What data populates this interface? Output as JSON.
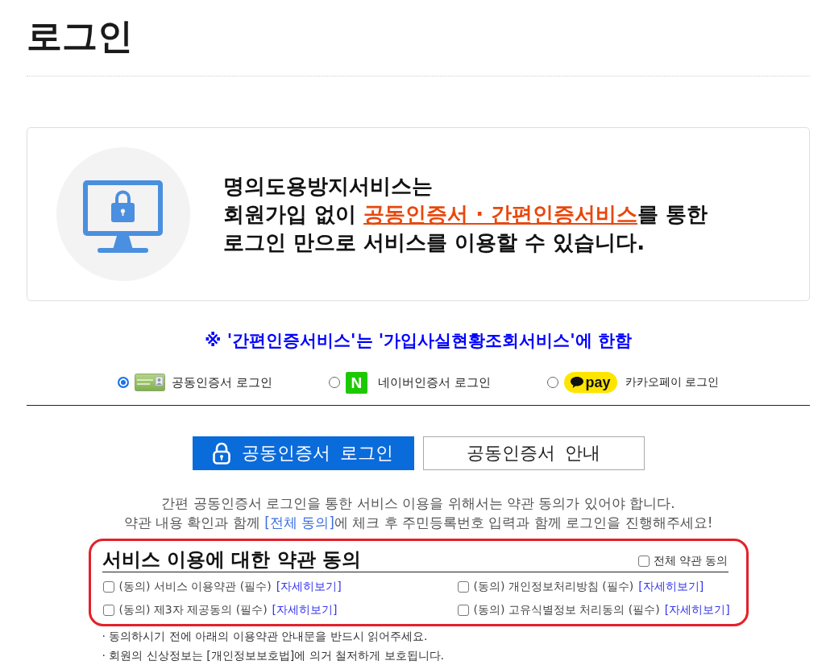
{
  "page_title": "로그인",
  "intro": {
    "line_1": "명의도용방지서비스는",
    "line_2_before": "회원가입 없이 ",
    "link": "공동인증서 · 간편인증서비스",
    "line_2_after": "를 통한",
    "line_3": "로그인 만으로 서비스를 이용할 수 있습니다."
  },
  "notice": "※ '간편인증서비스'는 '가입사실현황조회서비스'에 한함",
  "login_methods": [
    {
      "kind": "certificate",
      "label": "공동인증서 로그인",
      "selected": true
    },
    {
      "kind": "naver",
      "logo_text": "N",
      "label": "네이버인증서 로그인",
      "selected": false
    },
    {
      "kind": "kakaopay",
      "logo_text": "pay",
      "label": "카카오페이 로그인",
      "selected": false
    }
  ],
  "buttons": [
    {
      "kind": "primary",
      "label": "공동인증서 로그인"
    },
    {
      "kind": "secondary",
      "label": "공동인증서 안내"
    }
  ],
  "agreement_notice": {
    "line_1": "간편 공동인증서 로그인을 통한 서비스 이용을 위해서는 약관 동의가 있어야 합니다.",
    "line_2_before": "약관 내용 확인과 함께 ",
    "highlight": "[전체 동의]",
    "line_2_after": "에 체크 후 주민등록번호 입력과 함께 로그인을 진행해주세요!"
  },
  "terms": {
    "title": "서비스 이용에 대한 약관 동의",
    "agree_all": {
      "label": "전체 약관 동의",
      "checked": false
    },
    "items": [
      {
        "label": "(동의) 서비스 이용약관 (필수)",
        "link": "[자세히보기]",
        "checked": false
      },
      {
        "label": "(동의) 개인정보처리방침 (필수)",
        "link": "[자세히보기]",
        "checked": false
      },
      {
        "label": "(동의) 제3자 제공동의 (필수)",
        "link": "[자세히보기]",
        "checked": false
      },
      {
        "label": "(동의) 고유식별정보 처리동의 (필수)",
        "link": "[자세히보기]",
        "checked": false
      }
    ]
  },
  "notes": [
    "· 동의하시기 전에 아래의 이용약관 안내문을 반드시 읽어주세요.",
    "· 회원의 신상정보는 [개인정보보호법]에 의거 철저하게 보호됩니다."
  ]
}
